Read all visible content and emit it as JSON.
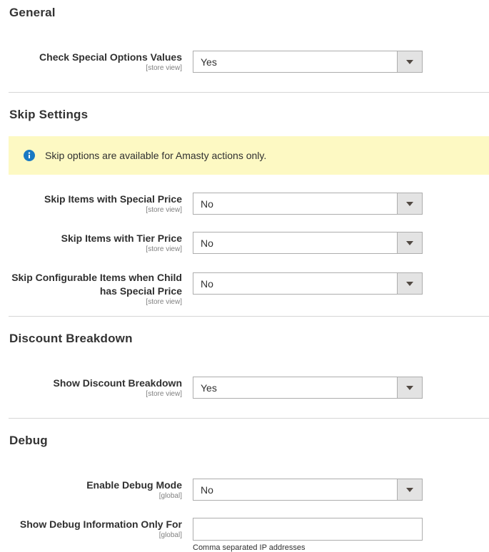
{
  "sections": {
    "general": {
      "title": "General",
      "check_special": {
        "label": "Check Special Options Values",
        "scope": "[store view]",
        "value": "Yes"
      }
    },
    "skip": {
      "title": "Skip Settings",
      "notice": "Skip options are available for Amasty actions only.",
      "special_price": {
        "label": "Skip Items with Special Price",
        "scope": "[store view]",
        "value": "No"
      },
      "tier_price": {
        "label": "Skip Items with Tier Price",
        "scope": "[store view]",
        "value": "No"
      },
      "configurable": {
        "label_line1": "Skip Configurable Items when Child",
        "label_line2": "has Special Price",
        "scope": "[store view]",
        "value": "No"
      }
    },
    "discount": {
      "title": "Discount Breakdown",
      "show_breakdown": {
        "label": "Show Discount Breakdown",
        "scope": "[store view]",
        "value": "Yes"
      }
    },
    "debug": {
      "title": "Debug",
      "enable": {
        "label": "Enable Debug Mode",
        "scope": "[global]",
        "value": "No"
      },
      "only_for": {
        "label": "Show Debug Information Only For",
        "scope": "[global]",
        "value": "",
        "hint": "Comma separated IP addresses"
      }
    }
  },
  "icons": {
    "info": "info-icon",
    "dropdown": "chevron-down-icon"
  },
  "colors": {
    "notice_bg": "#fdf9c3",
    "info_icon": "#1979c3"
  }
}
